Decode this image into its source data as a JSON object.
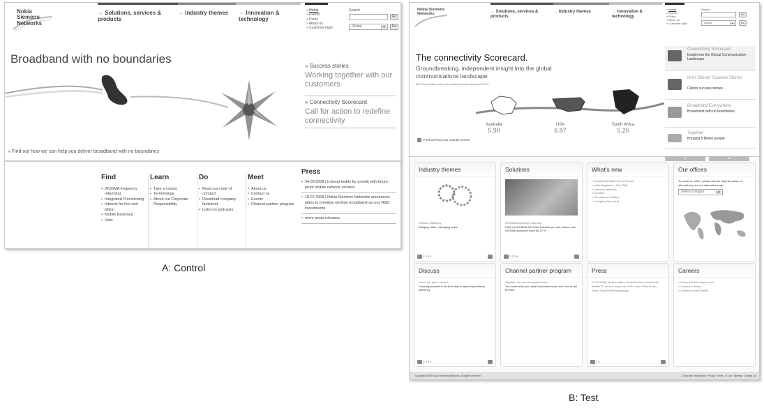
{
  "control": {
    "logo": "Nokia Siemens Networks",
    "nav": [
      "Solutions, services & products",
      "Industry themes",
      "Innovation & technology"
    ],
    "utility_links": [
      "Home",
      "Events",
      "Press",
      "About us",
      "Customer login"
    ],
    "search_label": "Search",
    "search_go": "Go",
    "select_value": "Global",
    "select_go": "Go",
    "hero_title": "Broadband with no boundaries",
    "side_items": [
      {
        "title": "Success stories",
        "subtitle": "Working together with our customers"
      },
      {
        "title": "Connectivity Scorecard",
        "subtitle": "Call for action to redefine connectivity"
      }
    ],
    "find_out": "Find out how we can help you deliver broadband with no boundaries",
    "columns": [
      {
        "heading": "Find",
        "items": [
          "WCDMA frequency refarming",
          "Integrated Provisioning",
          "Internet for the next billion",
          "Mobile Backhaul",
          "Jobs"
        ]
      },
      {
        "heading": "Learn",
        "items": [
          "Take a course",
          "Terminology",
          "About our Corporate Responsibility"
        ]
      },
      {
        "heading": "Do",
        "items": [
          "Read our code of conduct",
          "Download company factsheet",
          "Listen to podcasts"
        ]
      },
      {
        "heading": "Meet",
        "items": [
          "About us",
          "Contact us",
          "Events",
          "Channel partner program"
        ]
      }
    ],
    "press": {
      "heading": "Press",
      "items": [
        "04.09.2008 | Indosat builds for growth with future-proof mobile network solution",
        "18.07.2008 | Nokia Siemens Networks announces plans to prioritize wireline broadband access R&D investments",
        "more press releases"
      ]
    }
  },
  "test": {
    "logo": "Nokia Siemens Networks",
    "nav": [
      "Solutions, services & products",
      "Industry themes",
      "Innovation & technology"
    ],
    "utility_links": [
      "Home",
      "Events",
      "Press",
      "About us",
      "Customer login"
    ],
    "search_label": "Search",
    "search_go": "Go",
    "select_value": "Global",
    "select_go": "Go",
    "scorecard": {
      "title": "The connectivity Scorecard.",
      "subtitle": "Groundbreaking, independent insight into the global communications landscape",
      "byline": "By Professor Waverman of the London Business School and LECG",
      "countries": [
        {
          "name": "Australia",
          "score": "5.90"
        },
        {
          "name": "USA",
          "score": "6.97"
        },
        {
          "name": "South Africa",
          "score": "5.26"
        }
      ],
      "find_country": "Find out how your country scores"
    },
    "tabs": [
      {
        "title": "Connectivity Scorecard",
        "subtitle": "Insight into the Global Communication Landscape"
      },
      {
        "title": "NSN Clients' Success Stories",
        "subtitle": "Clients success stories ..."
      },
      {
        "title": "Broadband Everywhere",
        "subtitle": "Broadband with no boundaries"
      },
      {
        "title": "Together",
        "subtitle": "Bringing 5 Billion people"
      }
    ],
    "cards": {
      "industry": {
        "heading": "Industry themes",
        "link": "Network efficiency",
        "text": "Bringing value, managing costs",
        "pages": "1 2 3 4"
      },
      "solutions": {
        "heading": "Solutions",
        "link": "WCDMA frequency refarming",
        "text": "With our WCDMA 900 MHz Solution you can reduce your WCDMA spectrum need by 22 %",
        "pages": "1 2 3 4"
      },
      "whats_new": {
        "heading": "What's new",
        "items": [
          "Broadband World Forum Europe",
          "unite Magazine – Fall 2008",
          "Listen to podcasts",
          "Courses",
          "Our code of conduct",
          "Company fact sheet"
        ]
      },
      "offices": {
        "heading": "Our offices",
        "text": "To locate an office, please use the drop list below, or alternatively use our interactive map.",
        "select": "Select a region"
      },
      "discuss": {
        "heading": "Discuss",
        "link": "Prices up, you're down?",
        "text": "Knowing yourself is the first step to improving network efficiency.",
        "pages": "1 2 3 4"
      },
      "channel": {
        "heading": "Channel partner program",
        "link": "Together we can accomplish more",
        "text": "You know what your local customers want, and how to sell to them."
      },
      "press": {
        "heading": "Press",
        "link": "07.10.2008 | Qatar readies for world's first commercial Mobile TV service based on DVB-H and OMA BCast Smart Card Profile technology",
        "pages": "1 2"
      },
      "careers": {
        "heading": "Careers",
        "items": [
          "Find a job that inspires you",
          "Careers in India",
          "Careers in Asia Pacific"
        ]
      }
    },
    "footer_left": "Copyright 2008 Nokia Siemens Networks. All rights reserved",
    "footer_right": [
      "Corporate information",
      "Privacy",
      "Terms of use",
      "Sitemap",
      "Contact us"
    ]
  },
  "captions": {
    "a": "A: Control",
    "b": "B: Test"
  }
}
